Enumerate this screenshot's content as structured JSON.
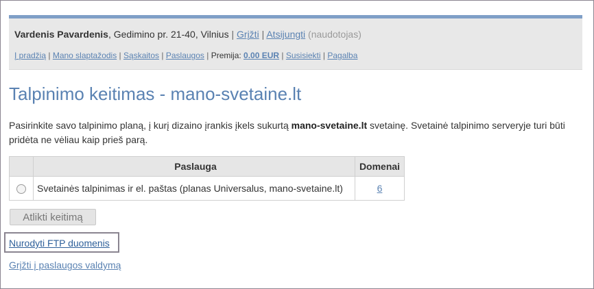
{
  "header": {
    "user_name": "Vardenis Pavardenis",
    "address": ", Gedimino pr. 21-40, Vilnius",
    "separator": " | ",
    "back_label": "Grįžti",
    "logout_label": "Atsijungti",
    "user_role": "(naudotojas)",
    "nav": {
      "home": "Į pradžią",
      "password": "Mano slaptažodis",
      "invoices": "Sąskaitos",
      "services": "Paslaugos",
      "bonus_label": "Premija:",
      "bonus_value": "0.00 EUR",
      "contact": "Susisiekti",
      "help": "Pagalba"
    }
  },
  "main": {
    "title": "Talpinimo keitimas - mano-svetaine.lt",
    "desc_part1": "Pasirinkite savo talpinimo planą, į kurį dizaino įrankis įkels sukurtą ",
    "desc_domain": "mano-svetaine.lt",
    "desc_part2": " svetainę. Svetainė talpinimo serveryje turi būti pridėta ne vėliau kaip prieš parą.",
    "table": {
      "headers": [
        "",
        "Paslauga",
        "Domenai"
      ],
      "rows": [
        {
          "service": "Svetainės talpinimas ir el. paštas (planas Universalus, mano-svetaine.lt)",
          "domains": "6"
        }
      ]
    },
    "submit_label": "Atlikti keitimą",
    "ftp_link": "Nurodyti FTP duomenis",
    "back_services_link": "Grįžti į paslaugos valdymą"
  }
}
